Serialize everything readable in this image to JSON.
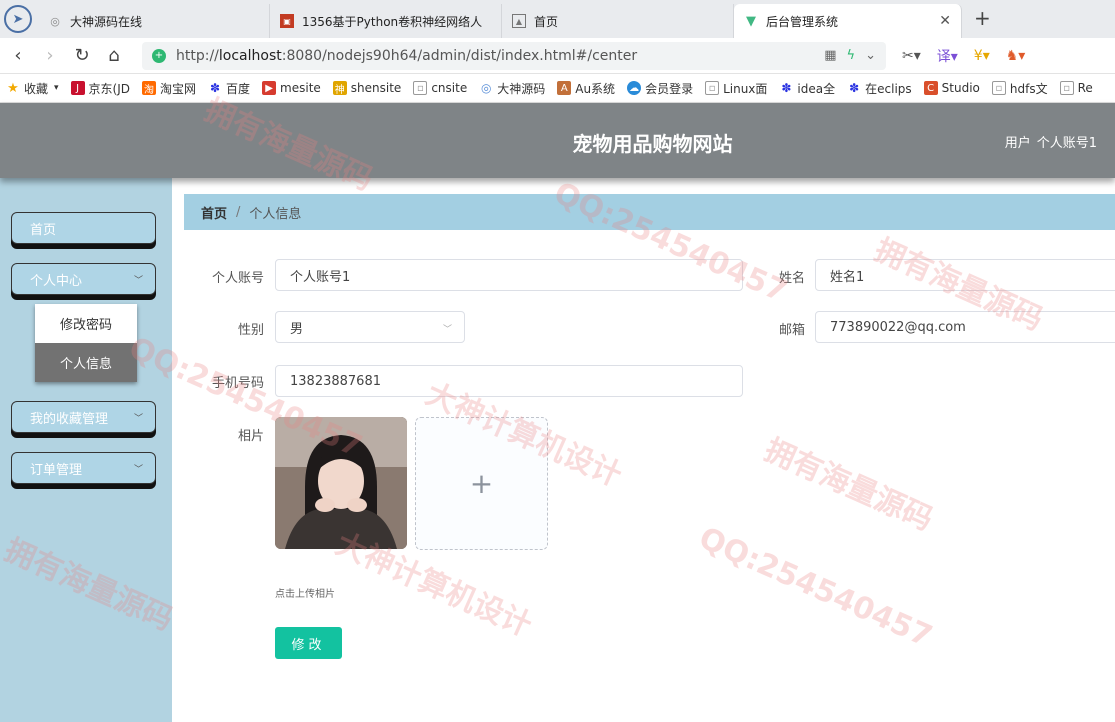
{
  "browser": {
    "tabs": [
      {
        "title": "大神源码在线",
        "icon": "globe-icon",
        "active": false
      },
      {
        "title": "1356基于Python卷积神经网络人",
        "icon": "page-icon",
        "active": false
      },
      {
        "title": "首页",
        "icon": "image-icon",
        "active": false
      },
      {
        "title": "后台管理系统",
        "icon": "vue-icon",
        "active": true
      }
    ],
    "url_scheme": "http://",
    "url_host": "localhost",
    "url_rest": ":8080/nodejs90h64/admin/dist/index.html#/center",
    "translate_label": "译",
    "bookmarks": [
      "收藏",
      "京东(JD",
      "淘宝网",
      "百度",
      "mesite",
      "shensite",
      "cnsite",
      "大神源码",
      "Au系统",
      "会员登录",
      "Linux面",
      "idea全",
      "在eclips",
      "Studio",
      "hdfs文",
      "Re"
    ]
  },
  "header": {
    "title": "宠物用品购物网站",
    "user_label": "用户",
    "user_name": "个人账号1"
  },
  "sidebar": {
    "home": "首页",
    "personal_center": "个人中心",
    "change_password": "修改密码",
    "personal_info": "个人信息",
    "favorites": "我的收藏管理",
    "orders": "订单管理"
  },
  "breadcrumb": {
    "home": "首页",
    "separator": "/",
    "current": "个人信息"
  },
  "form": {
    "account_label": "个人账号",
    "account_value": "个人账号1",
    "name_label": "姓名",
    "name_value": "姓名1",
    "gender_label": "性别",
    "gender_value": "男",
    "email_label": "邮箱",
    "email_value": "773890022@qq.com",
    "phone_label": "手机号码",
    "phone_value": "13823887681",
    "photo_label": "相片",
    "upload_hint": "点击上传相片",
    "submit_label": "修改"
  },
  "watermarks": [
    "拥有海量源码",
    "QQ:254540457",
    "大神计算机设计"
  ]
}
